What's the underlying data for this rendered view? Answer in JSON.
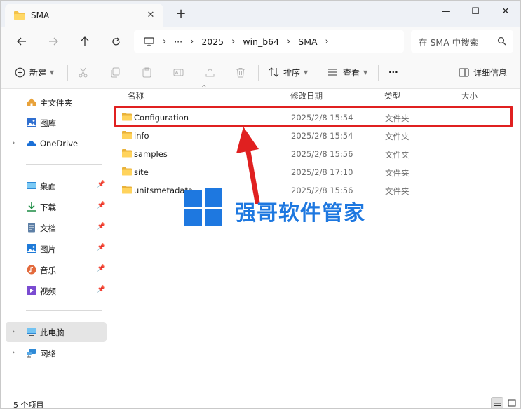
{
  "window": {
    "tab_title": "SMA",
    "tab_close": "✕",
    "new_tab": "+",
    "minimize": "—",
    "maximize": "☐",
    "close": "✕"
  },
  "nav": {
    "back_icon": "arrow-left-icon",
    "forward_icon": "arrow-right-icon",
    "up_icon": "arrow-up-icon",
    "refresh_icon": "refresh-icon",
    "more_crumbs": "···",
    "breadcrumbs": [
      "2025",
      "win_b64",
      "SMA"
    ],
    "search_placeholder": "在 SMA 中搜索"
  },
  "toolbar": {
    "new_label": "新建",
    "sort_label": "排序",
    "view_label": "查看",
    "more_label": "···",
    "details_label": "详细信息"
  },
  "sidebar": {
    "top_items": [
      {
        "label": "主文件夹",
        "icon": "home-icon"
      },
      {
        "label": "图库",
        "icon": "gallery-icon"
      },
      {
        "label": "OneDrive",
        "icon": "cloud-icon"
      }
    ],
    "quick_items": [
      {
        "label": "桌面",
        "icon": "desktop-icon"
      },
      {
        "label": "下载",
        "icon": "download-icon"
      },
      {
        "label": "文档",
        "icon": "document-icon"
      },
      {
        "label": "图片",
        "icon": "picture-icon"
      },
      {
        "label": "音乐",
        "icon": "music-icon"
      },
      {
        "label": "视频",
        "icon": "video-icon"
      }
    ],
    "bottom_items": [
      {
        "label": "此电脑",
        "icon": "pc-icon"
      },
      {
        "label": "网络",
        "icon": "network-icon"
      }
    ]
  },
  "columns": {
    "name": "名称",
    "modified": "修改日期",
    "type": "类型",
    "size": "大小"
  },
  "files": [
    {
      "name": "Configuration",
      "modified": "2025/2/8 15:54",
      "type": "文件夹"
    },
    {
      "name": "info",
      "modified": "2025/2/8 15:54",
      "type": "文件夹"
    },
    {
      "name": "samples",
      "modified": "2025/2/8 15:56",
      "type": "文件夹"
    },
    {
      "name": "site",
      "modified": "2025/2/8 17:10",
      "type": "文件夹"
    },
    {
      "name": "unitsmetadata",
      "modified": "2025/2/8 15:56",
      "type": "文件夹"
    }
  ],
  "status": {
    "item_count": "5 个项目"
  },
  "watermark": {
    "text": "强哥软件管家"
  },
  "colors": {
    "accent": "#1e78e0",
    "highlight": "#e02020",
    "folder": "#f3c24a"
  }
}
